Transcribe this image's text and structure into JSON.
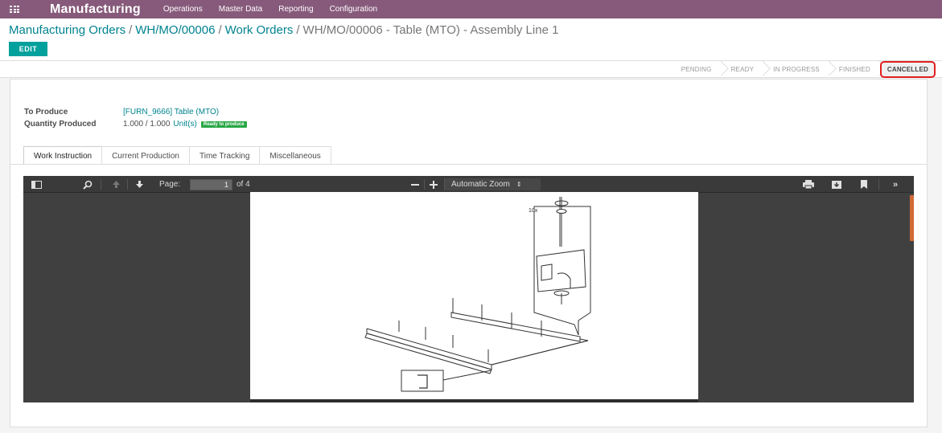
{
  "topbar": {
    "app_name": "Manufacturing",
    "menu": [
      "Operations",
      "Master Data",
      "Reporting",
      "Configuration"
    ]
  },
  "breadcrumb": {
    "items": [
      "Manufacturing Orders",
      "WH/MO/00006",
      "Work Orders"
    ],
    "current": "WH/MO/00006 - Table (MTO) - Assembly Line 1",
    "separator": "/"
  },
  "buttons": {
    "edit": "EDIT"
  },
  "statusbar": {
    "stages": [
      "PENDING",
      "READY",
      "IN PROGRESS",
      "FINISHED",
      "CANCELLED"
    ],
    "current": "CANCELLED"
  },
  "form": {
    "to_produce_label": "To Produce",
    "to_produce_value": "[FURN_9666] Table (MTO)",
    "qty_label": "Quantity Produced",
    "qty_value": "1.000",
    "qty_sep": " / ",
    "qty_total": "1.000",
    "qty_unit": "Unit(s)",
    "badge": "Ready to produce"
  },
  "tabs": [
    "Work Instruction",
    "Current Production",
    "Time Tracking",
    "Miscellaneous"
  ],
  "active_tab": "Work Instruction",
  "pdf_viewer": {
    "page_label": "Page:",
    "page_value": "1",
    "page_of": "of 4",
    "zoom": "Automatic Zoom",
    "figure_label": "10x"
  },
  "colors": {
    "topbar": "#875a7b",
    "link": "#00838f",
    "edit_button": "#00a09d",
    "badge": "#28a745",
    "highlight": "#e0201e"
  }
}
